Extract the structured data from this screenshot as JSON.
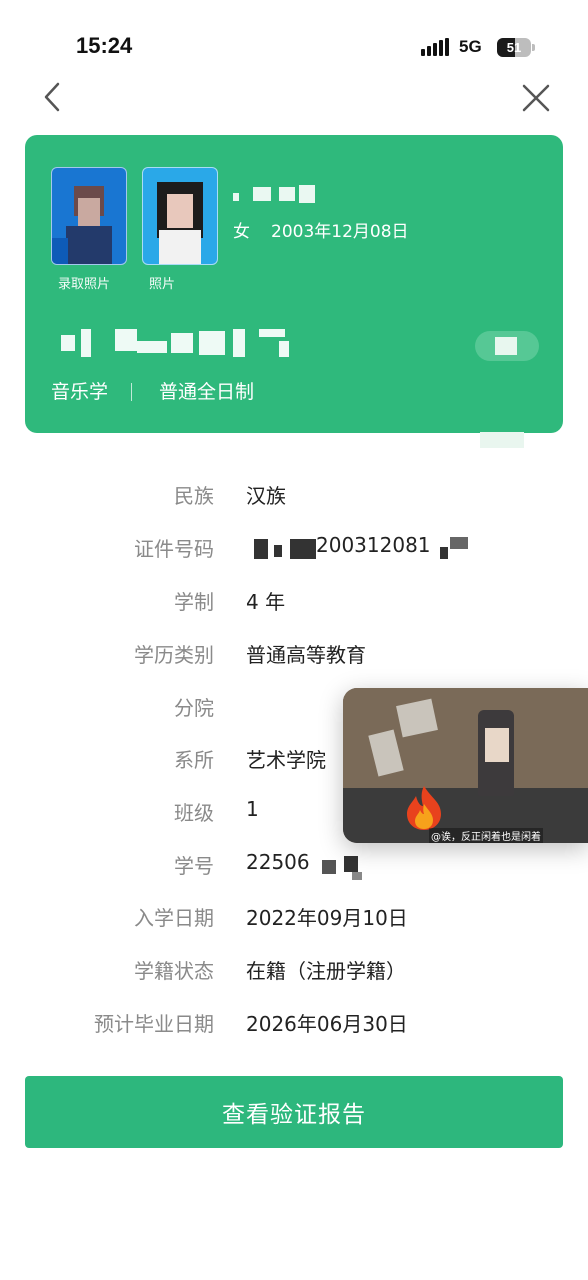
{
  "status_bar": {
    "time": "15:24",
    "network": "5G",
    "battery": "51"
  },
  "nav": {
    "back_icon": "chevron-left-icon",
    "close_icon": "close-icon"
  },
  "card": {
    "photo1_caption": "录取照片",
    "photo2_caption": "照片",
    "gender": "女",
    "birth_date": "2003年12月08日",
    "major": "音乐学",
    "study_mode": "普通全日制",
    "accent_color": "#2fb97c"
  },
  "details": {
    "ethnicity_label": "民族",
    "ethnicity_value": "汉族",
    "id_label": "证件号码",
    "id_value": "200312081",
    "duration_label": "学制",
    "duration_value": "4 年",
    "edu_type_label": "学历类别",
    "edu_type_value": "普通高等教育",
    "branch_label": "分院",
    "branch_value": "",
    "dept_label": "系所",
    "dept_value": "艺术学院",
    "class_label": "班级",
    "class_value": "1",
    "student_no_label": "学号",
    "student_no_value": "22506",
    "enroll_label": "入学日期",
    "enroll_value": "2022年09月10日",
    "status_label": "学籍状态",
    "status_value": "在籍（注册学籍）",
    "grad_label": "预计毕业日期",
    "grad_value": "2026年06月30日"
  },
  "video": {
    "caption": "@诶，反正闲着也是闲着"
  },
  "action": {
    "report_button": "查看验证报告",
    "button_color": "#2db77d"
  }
}
